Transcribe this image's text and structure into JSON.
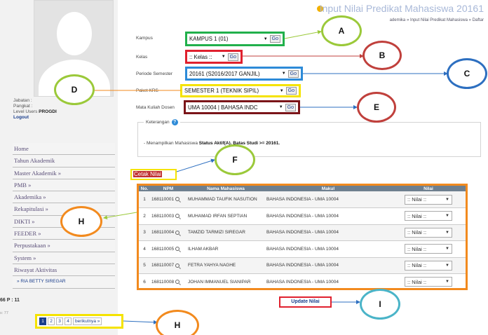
{
  "header": {
    "title": "Input Nilai Predikat Mahasiswa 20161",
    "breadcrumb": "ademika » Input Nilai Predikat Mahasiswa » Daftar"
  },
  "sidebar": {
    "user_info": {
      "jabatan": "Jabatan  :",
      "pangkat": "Pangkat  :",
      "level_prefix": "Level Users ",
      "level_value": "PROGDI",
      "logout": "Logout"
    },
    "menu": [
      "Home",
      "Tahun Akademik",
      "Master Akademik »",
      "PMB »",
      "Akademika »",
      "Rekapitulasi »",
      "DIKTI »",
      "FEEDER »",
      "Perpustakaan »",
      "System »",
      "Riwayat Aktivitas",
      "» RIA BETTY SIREGAR"
    ],
    "stats": "66  P : 11",
    "stats2": "s: 77"
  },
  "form": {
    "kampus": {
      "label": "Kampus",
      "value": "KAMPUS 1 (01)"
    },
    "kelas": {
      "label": "Kelas",
      "value": ":: Kelas ::"
    },
    "periode": {
      "label": "Periode Semester",
      "value": "20161 (S2016/2017 GANJIL)"
    },
    "paket": {
      "label": "Paket KRS",
      "value": "SEMESTER 1 (TEKNIK SIPIL)"
    },
    "matkul": {
      "label": "Mata Kuliah Dosen",
      "value": "UMA 10004 | BAHASA INDC"
    },
    "go_label": "Go"
  },
  "info": {
    "legend": "Keterangan",
    "help_glyph": "?",
    "text_prefix": "- Menampilkan Mahasiswa ",
    "text_bold": "Status Aktif(A). Batas Studi >= 20161."
  },
  "cetak_label": "Cetak Nilai",
  "table": {
    "headers": [
      "No.",
      "NPM",
      "Nama Mahasiswa",
      "Makul",
      "Nilai"
    ],
    "rows": [
      {
        "no": "1",
        "npm": "168110001",
        "nama": "MUHAMMAD TAUFIK NASUTION",
        "makul": "BAHASA INDONESIA - UMA 10004"
      },
      {
        "no": "2",
        "npm": "168110003",
        "nama": "MUHAMAD IRFAN SEPTIAN",
        "makul": "BAHASA INDONESIA - UMA 10004"
      },
      {
        "no": "3",
        "npm": "168110004",
        "nama": "TAMZID TARMIZI SIREGAR",
        "makul": "BAHASA INDONESIA - UMA 10004"
      },
      {
        "no": "4",
        "npm": "168110005",
        "nama": "ILHAM AKBAR",
        "makul": "BAHASA INDONESIA - UMA 10004"
      },
      {
        "no": "5",
        "npm": "168110007",
        "nama": "FETRA YAHYA NAGHE",
        "makul": "BAHASA INDONESIA - UMA 10004"
      },
      {
        "no": "6",
        "npm": "168110008",
        "nama": "JOHAN IMMANUEL SIANIPAR",
        "makul": "BAHASA INDONESIA - UMA 10004"
      }
    ],
    "nilai_placeholder": ":: Nilai ::"
  },
  "update_label": "Update Nilai",
  "pager": {
    "pages": [
      "1",
      "2",
      "3",
      "4"
    ],
    "next": "berikutnya »"
  },
  "callouts": {
    "A": "A",
    "B": "B",
    "C": "C",
    "D": "D",
    "E": "E",
    "F": "F",
    "H1": "H",
    "H2": "H",
    "I": "I"
  },
  "colors": {
    "green": "#21b04b",
    "red": "#e0212e",
    "blue": "#2d8bd8",
    "yellow": "#f5e300",
    "maroon": "#7b1519",
    "orange": "#f28a1e",
    "cyan": "#4ab4c8",
    "lime": "#9bc93a",
    "callout_red": "#c0403c"
  }
}
